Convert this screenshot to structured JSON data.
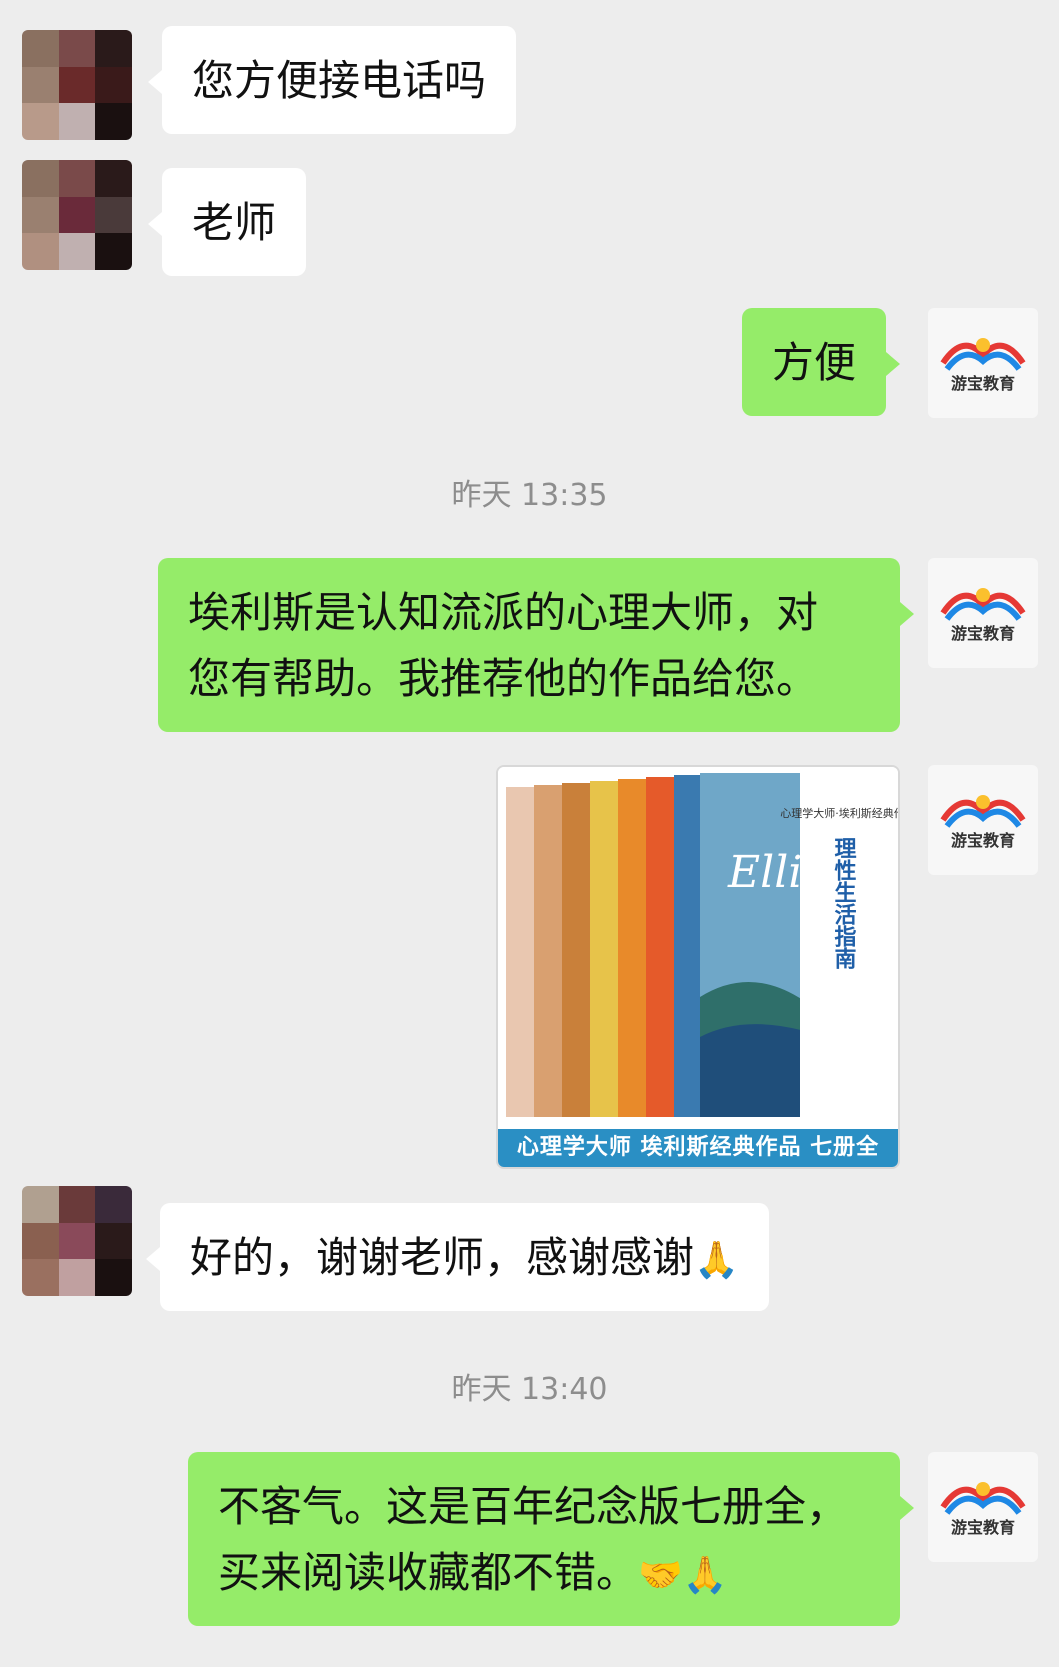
{
  "messages": {
    "m1": "您方便接电话吗",
    "m2": "老师",
    "m3": "方便",
    "t1": "昨天 13:35",
    "m4_line1": "埃利斯是认知流派的心理大师，对",
    "m4_line2": "您有帮助。我推荐他的作品给您。",
    "image_caption": "心理学大师  埃利斯经典作品  七册全",
    "book_title": "理性生活指南",
    "book_series": "心理学大师·埃利斯经典作品",
    "m5": "好的，谢谢老师，感谢感谢",
    "t2": "昨天 13:40",
    "m6_line1": "不客气。这是百年纪念版七册全，",
    "m6_line2": "买来阅读收藏都不错。"
  },
  "avatars": {
    "self_logo_text": "游宝教育"
  },
  "icons": [
    "pray-emoji",
    "handshake-emoji"
  ],
  "colors": {
    "background": "#ededed",
    "bubble_in": "#ffffff",
    "bubble_out": "#95ec69",
    "timestamp": "#8d8d8d"
  }
}
